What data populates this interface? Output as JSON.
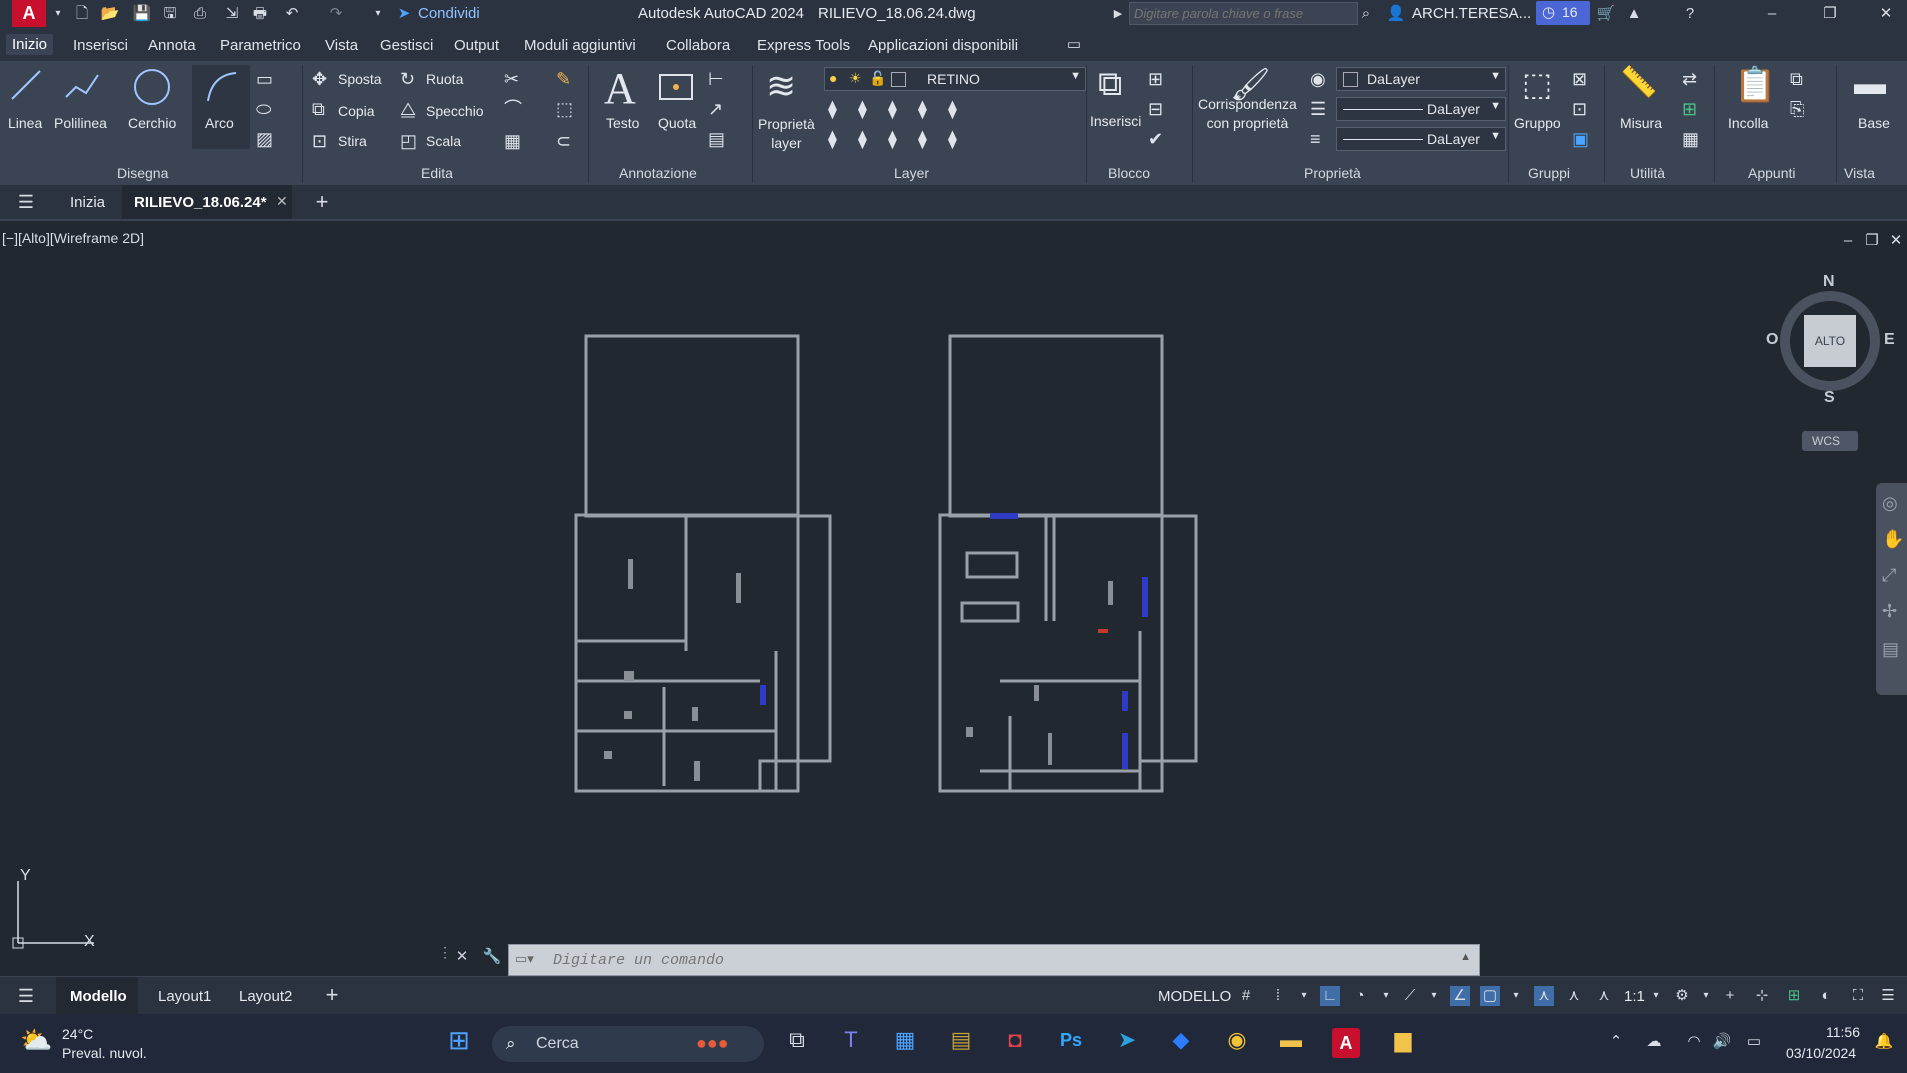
{
  "titlebar": {
    "share_label": "Condividi",
    "app_title": "Autodesk AutoCAD 2024",
    "file_title": "RILIEVO_18.06.24.dwg",
    "search_placeholder": "Digitare parola chiave o frase",
    "user_name": "ARCH.TERESA...",
    "notification_count": "16"
  },
  "ribbon_tabs": [
    "Inizio",
    "Inserisci",
    "Annota",
    "Parametrico",
    "Vista",
    "Gestisci",
    "Output",
    "Moduli aggiuntivi",
    "Collabora",
    "Express Tools",
    "Applicazioni disponibili"
  ],
  "panels": {
    "disegna": {
      "title": "Disegna",
      "linea": "Linea",
      "polilinea": "Polilinea",
      "cerchio": "Cerchio",
      "arco": "Arco"
    },
    "edita": {
      "title": "Edita",
      "sposta": "Sposta",
      "ruota": "Ruota",
      "copia": "Copia",
      "specchio": "Specchio",
      "stira": "Stira",
      "scala": "Scala"
    },
    "annotazione": {
      "title": "Annotazione",
      "testo": "Testo",
      "quota": "Quota"
    },
    "layer": {
      "title": "Layer",
      "proprieta_layer": "Proprietà\nlayer",
      "current_layer": "RETINO"
    },
    "blocco": {
      "title": "Blocco",
      "inserisci": "Inserisci"
    },
    "proprieta": {
      "title": "Proprietà",
      "corrispondenza": "Corrispondenza\ncon proprietà",
      "color": "DaLayer",
      "linetype": "DaLayer",
      "lineweight": "DaLayer"
    },
    "gruppi": {
      "title": "Gruppi",
      "gruppo": "Gruppo"
    },
    "utilita": {
      "title": "Utilità",
      "misura": "Misura"
    },
    "appunti": {
      "title": "Appunti",
      "incolla": "Incolla"
    },
    "vista": {
      "title": "Vista",
      "base": "Base"
    }
  },
  "file_tabs": {
    "home": "Inizia",
    "active": "RILIEVO_18.06.24*"
  },
  "viewport": {
    "label": "[−][Alto][Wireframe 2D]",
    "viewcube": {
      "top": "ALTO",
      "n": "N",
      "s": "S",
      "e": "E",
      "w": "O",
      "wcs": "WCS"
    },
    "ucs": {
      "x": "X",
      "y": "Y"
    }
  },
  "command": {
    "placeholder": "Digitare un comando"
  },
  "layout_tabs": [
    "Modello",
    "Layout1",
    "Layout2"
  ],
  "status": {
    "space": "MODELLO",
    "scale": "1:1"
  },
  "taskbar": {
    "temp": "24°C",
    "weather": "Preval. nuvol.",
    "search": "Cerca",
    "time": "11:56",
    "date": "03/10/2024"
  },
  "colors": {
    "accent": "#1f6fd1",
    "autocad_red": "#c8102e",
    "walls": "#8a8f96"
  }
}
